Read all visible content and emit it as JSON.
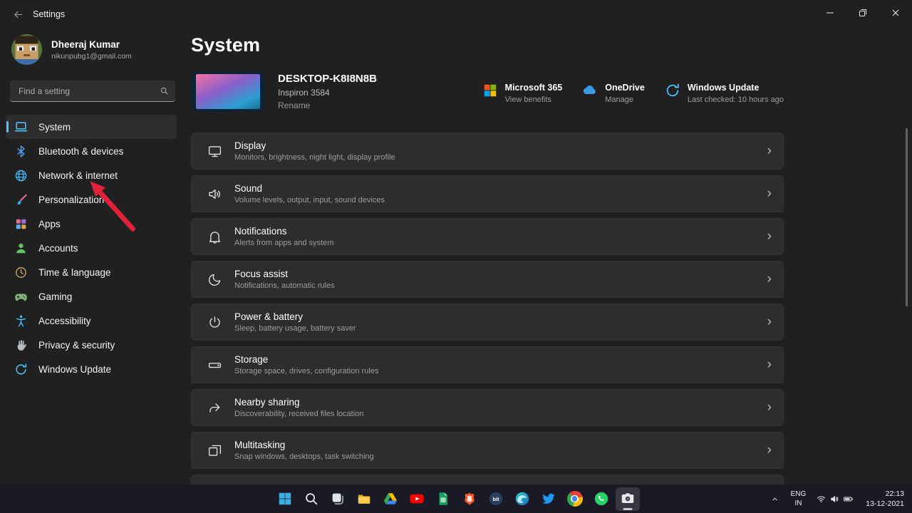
{
  "colors": {
    "accent": "#4cc2ff",
    "arrow_annotation": "#e0213a",
    "card_bg": "#2d2d2d",
    "page_bg": "#202020"
  },
  "titlebar": {
    "title": "Settings"
  },
  "sidebar": {
    "user": {
      "name": "Dheeraj Kumar",
      "email": "nikunpubg1@gmail.com"
    },
    "search_placeholder": "Find a setting",
    "items": [
      {
        "id": "system",
        "label": "System",
        "icon": "laptop-icon",
        "selected": true
      },
      {
        "id": "bluetooth-devices",
        "label": "Bluetooth & devices",
        "icon": "bluetooth-icon",
        "selected": false
      },
      {
        "id": "network-internet",
        "label": "Network & internet",
        "icon": "globe-icon",
        "selected": false
      },
      {
        "id": "personalization",
        "label": "Personalization",
        "icon": "brush-icon",
        "selected": false
      },
      {
        "id": "apps",
        "label": "Apps",
        "icon": "apps-grid-icon",
        "selected": false
      },
      {
        "id": "accounts",
        "label": "Accounts",
        "icon": "person-icon",
        "selected": false
      },
      {
        "id": "time-language",
        "label": "Time & language",
        "icon": "clock-icon",
        "selected": false
      },
      {
        "id": "gaming",
        "label": "Gaming",
        "icon": "controller-icon",
        "selected": false
      },
      {
        "id": "accessibility",
        "label": "Accessibility",
        "icon": "accessibility-icon",
        "selected": false
      },
      {
        "id": "privacy-security",
        "label": "Privacy & security",
        "icon": "hand-icon",
        "selected": false
      },
      {
        "id": "windows-update",
        "label": "Windows Update",
        "icon": "update-icon",
        "selected": false
      }
    ]
  },
  "main": {
    "page_title": "System",
    "device": {
      "name": "DESKTOP-K8I8N8B",
      "model": "Inspiron 3584",
      "rename_label": "Rename"
    },
    "quick_links": [
      {
        "id": "microsoft-365",
        "title": "Microsoft 365",
        "subtitle": "View benefits",
        "icon": "microsoft-icon"
      },
      {
        "id": "onedrive",
        "title": "OneDrive",
        "subtitle": "Manage",
        "icon": "cloud-icon"
      },
      {
        "id": "windows-update",
        "title": "Windows Update",
        "subtitle": "Last checked: 10 hours ago",
        "icon": "update-icon"
      }
    ],
    "rows": [
      {
        "id": "display",
        "title": "Display",
        "subtitle": "Monitors, brightness, night light, display profile",
        "icon": "display-icon"
      },
      {
        "id": "sound",
        "title": "Sound",
        "subtitle": "Volume levels, output, input, sound devices",
        "icon": "speaker-icon"
      },
      {
        "id": "notifications",
        "title": "Notifications",
        "subtitle": "Alerts from apps and system",
        "icon": "bell-icon"
      },
      {
        "id": "focus-assist",
        "title": "Focus assist",
        "subtitle": "Notifications, automatic rules",
        "icon": "moon-icon"
      },
      {
        "id": "power-battery",
        "title": "Power & battery",
        "subtitle": "Sleep, battery usage, battery saver",
        "icon": "power-icon"
      },
      {
        "id": "storage",
        "title": "Storage",
        "subtitle": "Storage space, drives, configuration rules",
        "icon": "drive-icon"
      },
      {
        "id": "nearby-sharing",
        "title": "Nearby sharing",
        "subtitle": "Discoverability, received files location",
        "icon": "share-icon"
      },
      {
        "id": "multitasking",
        "title": "Multitasking",
        "subtitle": "Snap windows, desktops, task switching",
        "icon": "multitask-icon"
      }
    ],
    "chevron": "›"
  },
  "taskbar": {
    "apps": [
      {
        "id": "start",
        "icon": "windows-logo-icon",
        "active": false
      },
      {
        "id": "search",
        "icon": "search-icon",
        "active": false
      },
      {
        "id": "task-view",
        "icon": "task-view-icon",
        "active": false
      },
      {
        "id": "file-explorer",
        "icon": "folder-icon",
        "active": false
      },
      {
        "id": "google-drive",
        "icon": "drive-triangle-icon",
        "active": false
      },
      {
        "id": "youtube",
        "icon": "youtube-icon",
        "active": false
      },
      {
        "id": "google-sheets",
        "icon": "sheets-icon",
        "active": false
      },
      {
        "id": "brave",
        "icon": "brave-icon",
        "active": false
      },
      {
        "id": "bitly",
        "icon": "bitly-icon",
        "active": false
      },
      {
        "id": "edge",
        "icon": "edge-icon",
        "active": false
      },
      {
        "id": "twitter",
        "icon": "twitter-icon",
        "active": false
      },
      {
        "id": "chrome",
        "icon": "chrome-icon",
        "active": false
      },
      {
        "id": "whatsapp",
        "icon": "whatsapp-icon",
        "active": false
      },
      {
        "id": "snipping-tool",
        "icon": "camera-icon",
        "active": true
      }
    ],
    "tray": {
      "language": "ENG",
      "region": "IN",
      "time": "22:13",
      "date": "13-12-2021"
    }
  }
}
